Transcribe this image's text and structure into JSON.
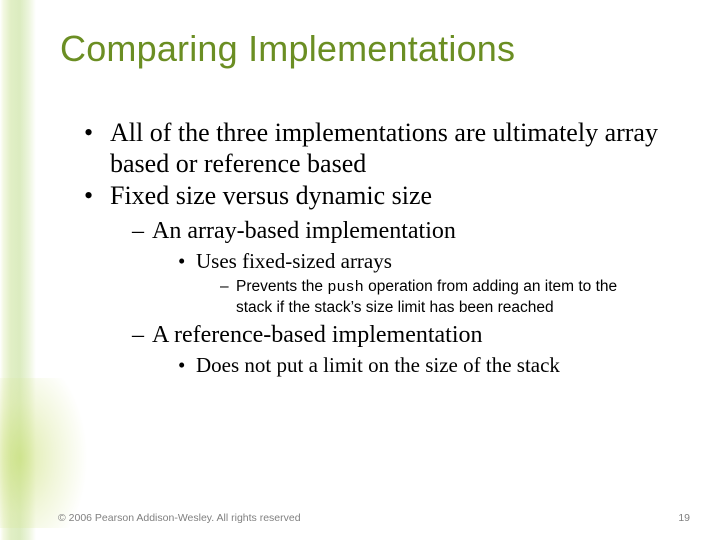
{
  "title": "Comparing Implementations",
  "bullets": {
    "b1": "All of the three implementations are ultimately array based or reference based",
    "b2": "Fixed size versus dynamic size",
    "b2a": "An array-based implementation",
    "b2a1": "Uses fixed-sized arrays",
    "b2a1a_pre": "Prevents the ",
    "b2a1a_code": "push",
    "b2a1a_post": " operation from adding an item to the stack if the stack’s size limit has been reached",
    "b2b": "A reference-based implementation",
    "b2b1": "Does not put a limit on the size of the stack"
  },
  "footer": "© 2006 Pearson Addison-Wesley. All rights reserved",
  "page": "19"
}
